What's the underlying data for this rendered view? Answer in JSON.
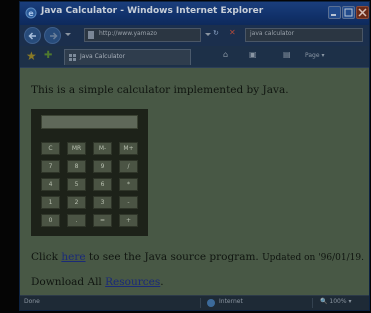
{
  "window": {
    "title": "Java Calculator - Windows Internet Explorer"
  },
  "navbar": {
    "url": "http://www.yamazo",
    "search_text": "java calculator"
  },
  "favbar": {
    "tab_label": "Java Calculator",
    "page_menu": "Page"
  },
  "page": {
    "intro": "This is a simple calculator implemented by Java.",
    "click_prefix": "Click ",
    "here_link": "here",
    "source_suffix": " to see the Java source program.",
    "updated": "Updated on '96/01/19.",
    "download_prefix": "Download All ",
    "resources_link": "Resources",
    "download_suffix": "."
  },
  "calculator": {
    "display_value": "",
    "keys": [
      "C",
      "MR",
      "M-",
      "M+",
      "7",
      "8",
      "9",
      "/",
      "4",
      "5",
      "6",
      "*",
      "1",
      "2",
      "3",
      "-",
      "0",
      ".",
      "=",
      "+"
    ]
  },
  "status": {
    "left": "Done",
    "zone": "Internet",
    "zoom": "100%"
  },
  "colors": {
    "content_bg": "#485845",
    "link": "#1a2a78",
    "titlebar": "#11316a"
  }
}
